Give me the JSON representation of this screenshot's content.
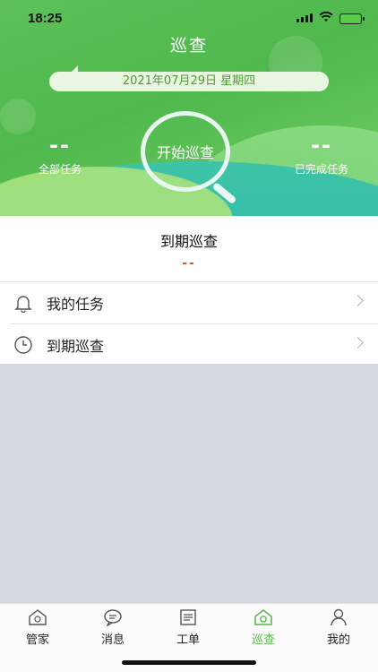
{
  "status_bar": {
    "time": "18:25"
  },
  "header": {
    "title": "巡查",
    "date_label": "2021年07月29日   星期四",
    "start_button": "开始巡查"
  },
  "stats": {
    "all_tasks": {
      "value": "--",
      "label": "全部任务"
    },
    "completed_tasks": {
      "value": "--",
      "label": "已完成任务"
    }
  },
  "due_card": {
    "title": "到期巡查",
    "value": "--"
  },
  "menu": {
    "items": [
      {
        "label": "我的任务",
        "icon": "bell-icon"
      },
      {
        "label": "到期巡查",
        "icon": "clock-icon"
      }
    ]
  },
  "tabbar": {
    "items": [
      {
        "label": "管家",
        "icon": "house-icon"
      },
      {
        "label": "消息",
        "icon": "chat-bubble-icon"
      },
      {
        "label": "工单",
        "icon": "work-order-icon"
      },
      {
        "label": "巡查",
        "icon": "patrol-icon",
        "active": true
      },
      {
        "label": "我的",
        "icon": "person-icon"
      }
    ],
    "active_color": "#5cb94c"
  },
  "colors": {
    "primary_green": "#4fb84c",
    "accent_orange": "#e3551f"
  }
}
